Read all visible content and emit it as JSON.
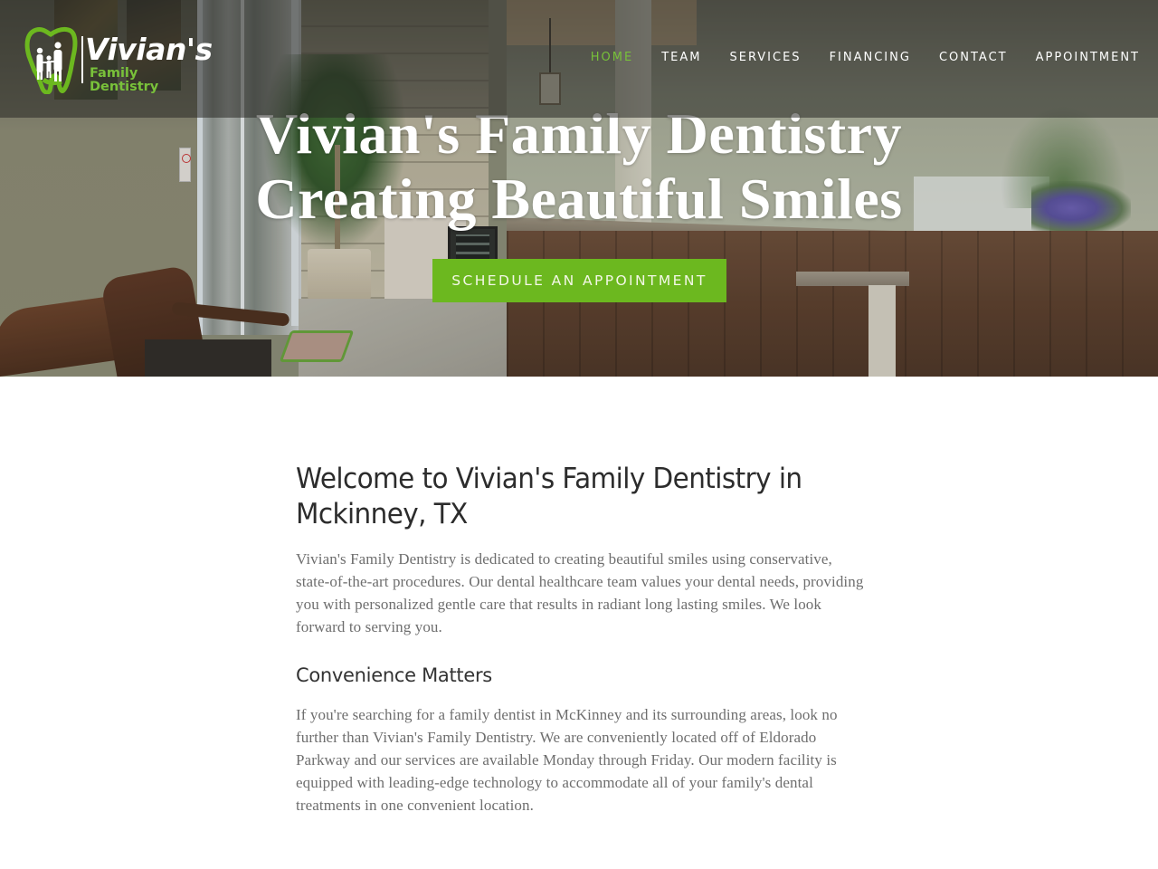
{
  "brand": {
    "logo_name": "Vivian's",
    "logo_subtitle": "Family Dentistry",
    "accent_color": "#6cb81f"
  },
  "nav": {
    "items": [
      {
        "label": "HOME",
        "active": true
      },
      {
        "label": "TEAM",
        "active": false
      },
      {
        "label": "SERVICES",
        "active": false
      },
      {
        "label": "FINANCING",
        "active": false
      },
      {
        "label": "CONTACT",
        "active": false
      },
      {
        "label": "APPOINTMENT",
        "active": false
      }
    ]
  },
  "hero": {
    "title_line1": "Vivian's Family Dentistry",
    "title_line2": "Creating Beautiful Smiles",
    "cta_label": "SCHEDULE AN APPOINTMENT"
  },
  "main": {
    "welcome_heading": "Welcome to Vivian's Family Dentistry in Mckinney, TX",
    "welcome_text": "Vivian's Family Dentistry is dedicated to creating beautiful smiles using conservative, state-of-the-art procedures. Our dental healthcare team values your dental needs, providing you with personalized gentle care that results in radiant long lasting smiles. We look forward to serving you.",
    "convenience_heading": "Convenience Matters",
    "convenience_text": "If you're searching for a family dentist in McKinney and its surrounding areas, look no further than Vivian's Family Dentistry. We are conveniently located off of Eldorado Parkway and our services are available Monday through Friday. Our modern facility is equipped with leading-edge technology to accommodate all of your family's dental treatments in one convenient location."
  }
}
